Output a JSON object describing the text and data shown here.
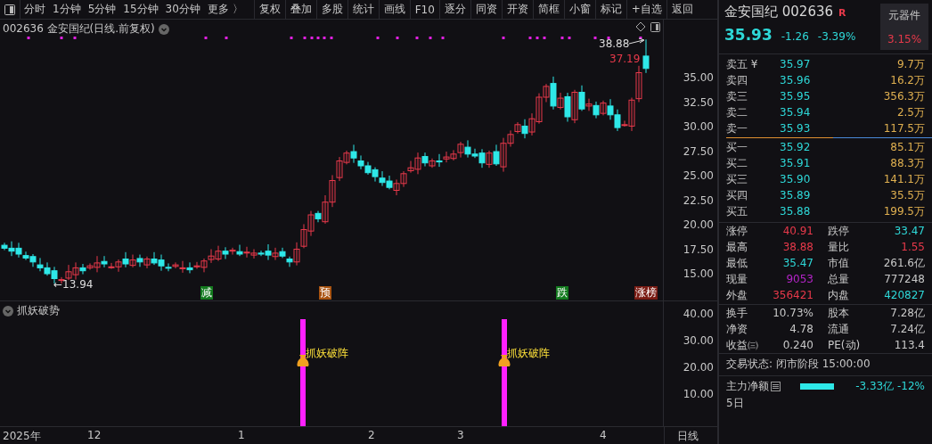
{
  "toolbar": {
    "periods": [
      "分时",
      "1分钟",
      "5分钟",
      "15分钟",
      "30分钟"
    ],
    "more": "更多 〉",
    "buttons": [
      "复权",
      "叠加",
      "多股",
      "统计",
      "画线",
      "F10",
      "逐分",
      "同资",
      "开资",
      "简框",
      "小窗",
      "标记",
      "+自选",
      "返回"
    ]
  },
  "chart": {
    "title": "002636 金安国纪(日线.前复权)",
    "yticks": [
      "35.00",
      "32.50",
      "30.00",
      "27.50",
      "25.00",
      "22.50",
      "20.00",
      "17.50",
      "15.00"
    ],
    "high_label": "38.88",
    "last_label": "37.19",
    "low_label": "←13.94",
    "signals": [
      {
        "label": "减",
        "color": "#137a1e"
      },
      {
        "label": "预",
        "color": "#a8520f"
      },
      {
        "label": "跌",
        "color": "#137a1e"
      },
      {
        "label": "涨榜",
        "color": "#7a1c14"
      }
    ]
  },
  "indicator": {
    "title": "抓妖破势",
    "yticks": [
      "40.00",
      "30.00",
      "20.00",
      "10.00"
    ],
    "signals": [
      {
        "label": "抓妖破阵"
      },
      {
        "label": "抓妖破阵"
      }
    ]
  },
  "date_axis": {
    "labels": [
      "2025年",
      "12",
      "1",
      "2",
      "3",
      "4"
    ],
    "period": "日线"
  },
  "quote": {
    "name": "金安国纪",
    "code": "002636",
    "badge": "R",
    "sector": "元器件",
    "sector_change": "3.15%",
    "price": "35.93",
    "change": "-1.26",
    "change_pct": "-3.39%",
    "asks": [
      {
        "label": "卖五 ¥",
        "price": "35.97",
        "volume": "9.7万"
      },
      {
        "label": "卖四",
        "price": "35.96",
        "volume": "16.2万"
      },
      {
        "label": "卖三",
        "price": "35.95",
        "volume": "356.3万"
      },
      {
        "label": "卖二",
        "price": "35.94",
        "volume": "2.5万"
      },
      {
        "label": "卖一",
        "price": "35.93",
        "volume": "117.5万"
      }
    ],
    "bids": [
      {
        "label": "买一",
        "price": "35.92",
        "volume": "85.1万"
      },
      {
        "label": "买二",
        "price": "35.91",
        "volume": "88.3万"
      },
      {
        "label": "买三",
        "price": "35.90",
        "volume": "141.1万"
      },
      {
        "label": "买四",
        "price": "35.89",
        "volume": "35.5万"
      },
      {
        "label": "买五",
        "price": "35.88",
        "volume": "199.5万"
      }
    ],
    "stats": [
      {
        "label": "涨停",
        "value": "40.91",
        "color": "#e8394a"
      },
      {
        "label": "跌停",
        "value": "33.47",
        "color": "#2ed8d8"
      },
      {
        "label": "最高",
        "value": "38.88",
        "color": "#e8394a"
      },
      {
        "label": "量比",
        "value": "1.55",
        "color": "#e8394a"
      },
      {
        "label": "最低",
        "value": "35.47",
        "color": "#2ed8d8"
      },
      {
        "label": "市值",
        "value": "261.6亿",
        "color": "#c8c8c8"
      },
      {
        "label": "现量",
        "value": "9053",
        "color": "#b424c8"
      },
      {
        "label": "总量",
        "value": "777248",
        "color": "#c8c8c8"
      },
      {
        "label": "外盘",
        "value": "356421",
        "color": "#e8394a"
      },
      {
        "label": "内盘",
        "value": "420827",
        "color": "#2ed8d8"
      }
    ],
    "finance": [
      {
        "label": "换手",
        "value": "10.73%",
        "label2": "股本",
        "value2": "7.28亿"
      },
      {
        "label": "净资",
        "value": "4.78",
        "label2": "流通",
        "value2": "7.24亿"
      },
      {
        "label": "收益㈢",
        "value": "0.240",
        "label2": "PE(动)",
        "value2": "113.4"
      }
    ],
    "status": "交易状态: 闭市阶段 15:00:00",
    "flow": {
      "label": "主力净额",
      "value": "-3.33亿 -12%"
    },
    "flow_5d": "5日"
  }
}
